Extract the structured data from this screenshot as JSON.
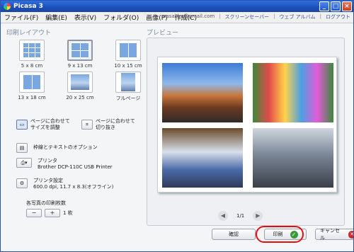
{
  "window": {
    "title": "Picasa 3"
  },
  "menu": {
    "items": [
      "ファイル(F)",
      "編集(E)",
      "表示(V)",
      "フォルダ(O)",
      "画像(P)",
      "作成(C)"
    ],
    "right": {
      "email": "masakjm@gmail.com",
      "screensaver": "スクリーンセーバー",
      "web_album": "ウェブ アルバム",
      "logout": "ログアウト"
    }
  },
  "print_layout": {
    "title": "印刷レイアウト",
    "layouts": [
      "5 x 8 cm",
      "9 x 13 cm",
      "10 x 15 cm",
      "13 x 18 cm",
      "20 x 25 cm",
      "フルページ"
    ],
    "fit_size": "ページに合わせてサイズを調整",
    "fit_crop": "ページに合わせて切り抜き",
    "border_options": "枠線とテキストのオプション",
    "printer_label": "プリンタ",
    "printer_name": "Brother DCP-110C USB Printer",
    "printer_settings_label": "プリンタ設定",
    "printer_settings_value": "600.0 dpi, 11.7 x 8.3(オフライン)",
    "copies_label": "各写真の印刷枚数",
    "copies_value": "1 枚"
  },
  "preview": {
    "title": "プレビュー",
    "page_indicator": "1/1"
  },
  "buttons": {
    "confirm": "確認",
    "print": "印刷",
    "cancel": "キャンセル"
  }
}
